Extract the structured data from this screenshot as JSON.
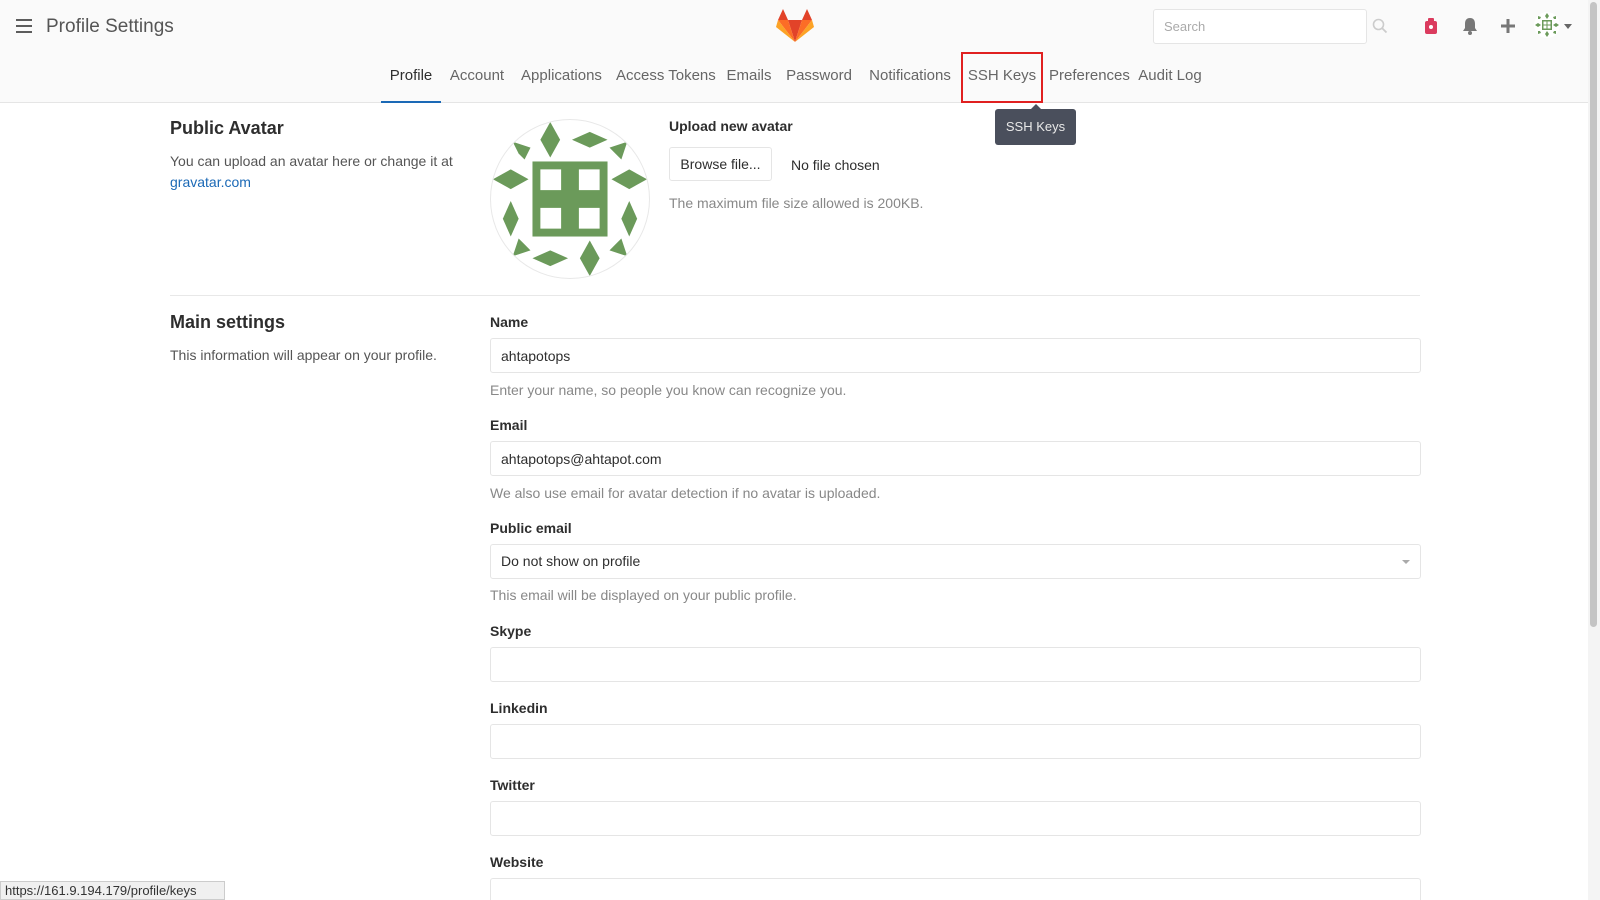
{
  "header": {
    "title": "Profile Settings",
    "search_placeholder": "Search"
  },
  "tabs": [
    {
      "label": "Profile",
      "active": true
    },
    {
      "label": "Account"
    },
    {
      "label": "Applications"
    },
    {
      "label": "Access Tokens"
    },
    {
      "label": "Emails"
    },
    {
      "label": "Password"
    },
    {
      "label": "Notifications"
    },
    {
      "label": "SSH Keys",
      "highlighted": true
    },
    {
      "label": "Preferences"
    },
    {
      "label": "Audit Log"
    }
  ],
  "tooltip": "SSH Keys",
  "avatar_section": {
    "title": "Public Avatar",
    "desc_prefix": "You can upload an avatar here or change it at",
    "link": "gravatar.com",
    "upload_label": "Upload new avatar",
    "browse_label": "Browse file...",
    "no_file": "No file chosen",
    "max_size_hint": "The maximum file size allowed is 200KB."
  },
  "main_settings": {
    "title": "Main settings",
    "desc": "This information will appear on your profile.",
    "name_label": "Name",
    "name_value": "ahtapotops",
    "name_hint": "Enter your name, so people you know can recognize you.",
    "email_label": "Email",
    "email_value": "ahtapotops@ahtapot.com",
    "email_hint": "We also use email for avatar detection if no avatar is uploaded.",
    "public_email_label": "Public email",
    "public_email_value": "Do not show on profile",
    "public_email_hint": "This email will be displayed on your public profile.",
    "skype_label": "Skype",
    "skype_value": "",
    "linkedin_label": "Linkedin",
    "linkedin_value": "",
    "twitter_label": "Twitter",
    "twitter_value": "",
    "website_label": "Website",
    "website_value": ""
  },
  "status_url": "https://161.9.194.179/profile/keys",
  "colors": {
    "avatar_green": "#6b9a5a",
    "accent_blue": "#1b69b6",
    "highlight_red": "#e02020"
  }
}
